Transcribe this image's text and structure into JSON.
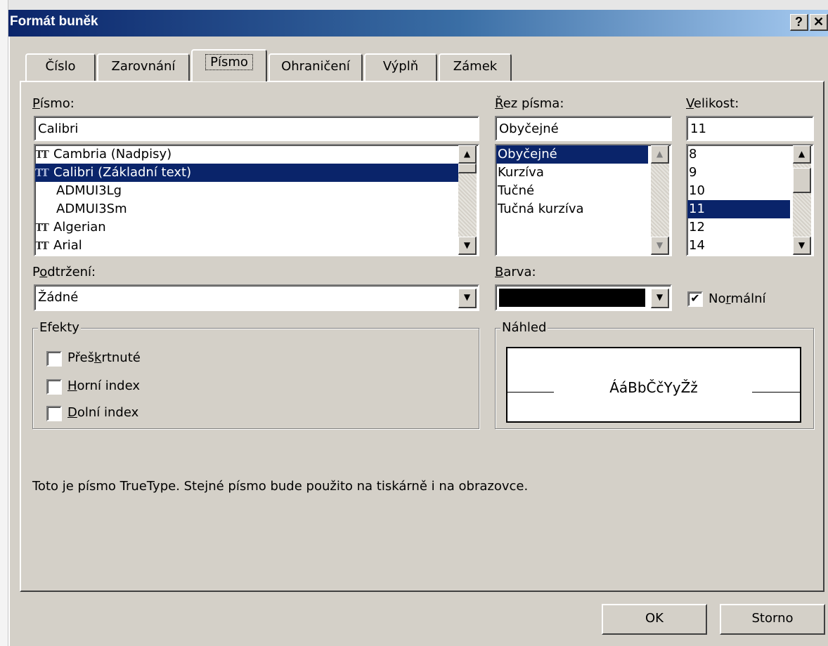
{
  "window": {
    "title": "Formát buněk",
    "help_label": "?",
    "close_label": "✕"
  },
  "tabs": [
    {
      "label": "Číslo",
      "active": false
    },
    {
      "label": "Zarovnání",
      "active": false
    },
    {
      "label": "Písmo",
      "active": true
    },
    {
      "label": "Ohraničení",
      "active": false
    },
    {
      "label": "Výplň",
      "active": false
    },
    {
      "label": "Zámek",
      "active": false
    }
  ],
  "font": {
    "label": "Písmo:",
    "value": "Calibri",
    "items": [
      {
        "text": "Cambria (Nadpisy)",
        "icon": "truetype-icon",
        "selected": false
      },
      {
        "text": "Calibri (Základní text)",
        "icon": "truetype-icon",
        "selected": true
      },
      {
        "text": "ADMUI3Lg",
        "icon": "",
        "selected": false
      },
      {
        "text": "ADMUI3Sm",
        "icon": "",
        "selected": false
      },
      {
        "text": "Algerian",
        "icon": "truetype-icon",
        "selected": false
      },
      {
        "text": "Arial",
        "icon": "truetype-icon",
        "selected": false
      }
    ]
  },
  "style": {
    "label": "Řez písma:",
    "value": "Obyčejné",
    "items": [
      "Obyčejné",
      "Kurzíva",
      "Tučné",
      "Tučná kurzíva"
    ],
    "selected_index": 0
  },
  "size": {
    "label": "Velikost:",
    "value": "11",
    "items": [
      "8",
      "9",
      "10",
      "11",
      "12",
      "14"
    ],
    "selected_index": 3
  },
  "underline": {
    "label": "Podtržení:",
    "value": "Žádné"
  },
  "color": {
    "label": "Barva:",
    "swatch": "#000000",
    "normal_label": "Normální",
    "normal_checked": true
  },
  "effects": {
    "title": "Efekty",
    "items": [
      {
        "label": "Přeškrtnuté",
        "checked": false
      },
      {
        "label": "Horní index",
        "checked": false
      },
      {
        "label": "Dolní index",
        "checked": false
      }
    ]
  },
  "preview": {
    "title": "Náhled",
    "sample": "ÁáBbČčYyŽž"
  },
  "info_text": "Toto je písmo TrueType. Stejné písmo bude použito na tiskárně i na obrazovce.",
  "buttons": {
    "ok": "OK",
    "cancel": "Storno"
  },
  "colors": {
    "title_start": "#0a246a",
    "title_end": "#a6caf0",
    "selection": "#0a246a",
    "face": "#d4d0c8"
  }
}
